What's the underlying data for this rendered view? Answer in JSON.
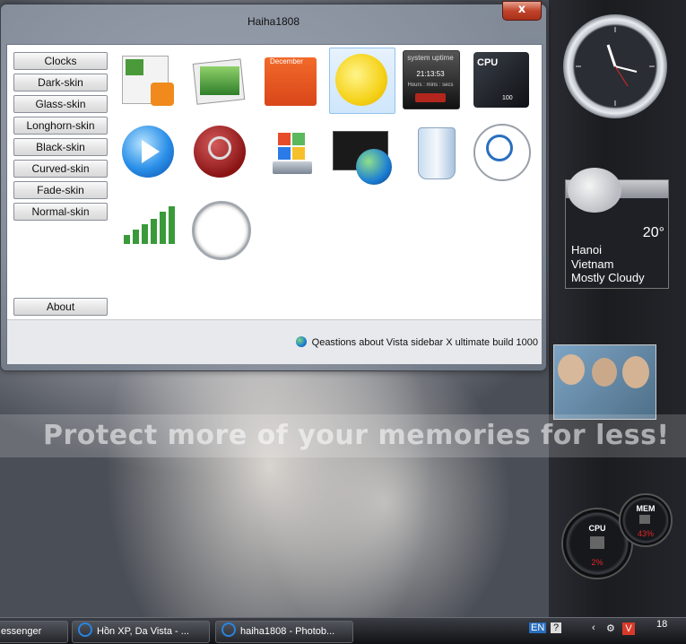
{
  "window": {
    "title": "Haiha1808",
    "close_label": "x",
    "status_text": "Qeastions about Vista sidebar X ultimate build 1000"
  },
  "sidebar": {
    "items": [
      {
        "label": "Clocks"
      },
      {
        "label": "Dark-skin"
      },
      {
        "label": "Glass-skin"
      },
      {
        "label": "Longhorn-skin"
      },
      {
        "label": "Black-skin"
      },
      {
        "label": "Curved-skin"
      },
      {
        "label": "Fade-skin"
      },
      {
        "label": "Normal-skin"
      }
    ],
    "about_label": "About"
  },
  "gadgets": [
    {
      "name": "feed-headlines-icon"
    },
    {
      "name": "slide-show-icon"
    },
    {
      "name": "calendar-icon",
      "text": "December"
    },
    {
      "name": "weather-sun-icon",
      "selected": true
    },
    {
      "name": "system-uptime-icon",
      "title": "system uptime",
      "time": "21:13:53",
      "caption": "Hours : mins : secs"
    },
    {
      "name": "cpu-meter-icon",
      "label": "CPU",
      "value": "100"
    },
    {
      "name": "media-player-icon"
    },
    {
      "name": "search-magnifier-red-icon"
    },
    {
      "name": "windows-computer-icon"
    },
    {
      "name": "network-globe-icon"
    },
    {
      "name": "recycle-bin-icon"
    },
    {
      "name": "search-magnifier-icon"
    },
    {
      "name": "signal-strength-icon"
    },
    {
      "name": "analog-clock-icon"
    }
  ],
  "weather_gadget": {
    "temp": "20°",
    "city": "Hanoi",
    "country": "Vietnam",
    "condition": "Mostly Cloudy"
  },
  "meters": {
    "cpu_label": "CPU",
    "cpu_value": "2%",
    "mem_label": "MEM",
    "mem_value": "43%"
  },
  "watermark": "Protect more of your memories for less!",
  "taskbar": {
    "items": [
      {
        "label": "essenger"
      },
      {
        "label": "Hồn XP, Da Vista - ..."
      },
      {
        "label": "haiha1808 - Photob..."
      }
    ],
    "lang": "EN",
    "clock": "18"
  }
}
